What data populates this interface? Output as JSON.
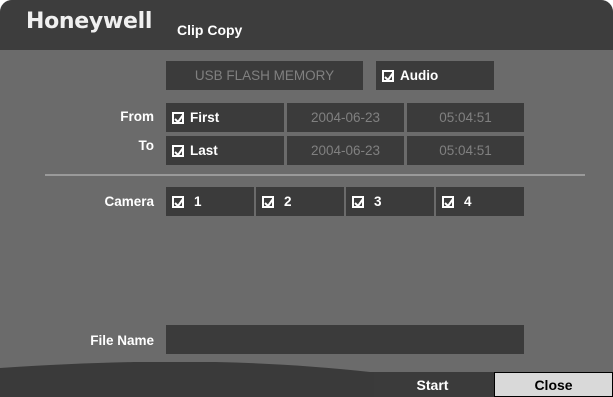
{
  "header": {
    "brand": "Honeywell",
    "title": "Clip Copy"
  },
  "media": {
    "device": "USB FLASH MEMORY",
    "audio_label": "Audio",
    "audio_checked": true
  },
  "range": {
    "from_label": "From",
    "to_label": "To",
    "from": {
      "option": "First",
      "checked": true,
      "date": "2004-06-23",
      "time": "05:04:51"
    },
    "to": {
      "option": "Last",
      "checked": true,
      "date": "2004-06-23",
      "time": "05:04:51"
    }
  },
  "camera": {
    "label": "Camera",
    "items": [
      {
        "label": "1",
        "checked": true
      },
      {
        "label": "2",
        "checked": true
      },
      {
        "label": "3",
        "checked": true
      },
      {
        "label": "4",
        "checked": true
      }
    ]
  },
  "file": {
    "label": "File Name",
    "value": ""
  },
  "buttons": {
    "start": "Start",
    "close": "Close"
  },
  "colors": {
    "panel": "#6b6b6b",
    "field": "#3b3b3b",
    "titlebar": "#3d3d3d",
    "close_button": "#d9d9d9"
  }
}
